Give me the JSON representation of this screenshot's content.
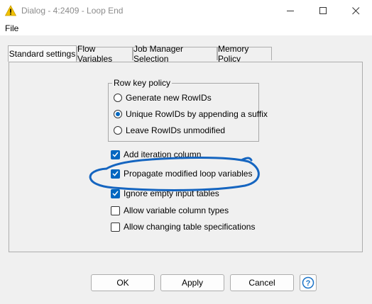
{
  "window": {
    "title": "Dialog - 4:2409 - Loop End",
    "icon": "warning-triangle-icon",
    "controls": [
      "minimize-icon",
      "maximize-icon",
      "close-icon"
    ]
  },
  "menu": {
    "file": "File"
  },
  "tabs": [
    {
      "label": "Standard settings",
      "active": true
    },
    {
      "label": "Flow Variables",
      "active": false
    },
    {
      "label": "Job Manager Selection",
      "active": false
    },
    {
      "label": "Memory Policy",
      "active": false
    }
  ],
  "row_key_policy": {
    "legend": "Row key policy",
    "options": [
      {
        "label": "Generate new RowIDs",
        "selected": false
      },
      {
        "label": "Unique RowIDs by appending a suffix",
        "selected": true
      },
      {
        "label": "Leave RowIDs unmodified",
        "selected": false
      }
    ]
  },
  "checkboxes": [
    {
      "label": "Add iteration column",
      "checked": true
    },
    {
      "label": "Propagate modified loop variables",
      "checked": true
    },
    {
      "label": "Ignore empty input tables",
      "checked": true
    },
    {
      "label": "Allow variable column types",
      "checked": false
    },
    {
      "label": "Allow changing table specifications",
      "checked": false
    }
  ],
  "buttons": {
    "ok": "OK",
    "apply": "Apply",
    "cancel": "Cancel",
    "help": "?"
  },
  "colors": {
    "accent": "#0067c0",
    "annotation": "#1565c0",
    "warning": "#f2c200"
  }
}
